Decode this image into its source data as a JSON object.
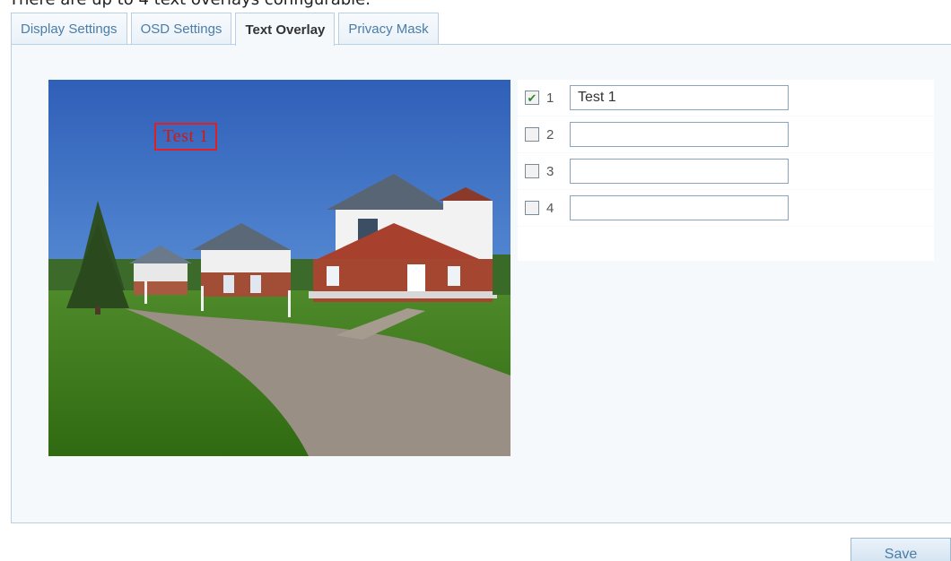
{
  "caption": "There are up to 4 text overlays configurable.",
  "tabs": [
    {
      "label": "Display Settings",
      "active": false
    },
    {
      "label": "OSD Settings",
      "active": false
    },
    {
      "label": "Text Overlay",
      "active": true
    },
    {
      "label": "Privacy Mask",
      "active": false
    }
  ],
  "preview": {
    "overlay_text": "Test 1"
  },
  "overlays": [
    {
      "number": "1",
      "checked": true,
      "value": "Test 1"
    },
    {
      "number": "2",
      "checked": false,
      "value": ""
    },
    {
      "number": "3",
      "checked": false,
      "value": ""
    },
    {
      "number": "4",
      "checked": false,
      "value": ""
    }
  ],
  "save_label": "Save",
  "colors": {
    "tab_text": "#4a7da8",
    "panel_border": "#b9cfe3",
    "overlay_border": "#e02020",
    "check_mark": "#2f8a2f"
  },
  "icons": {
    "checked": "✔"
  }
}
